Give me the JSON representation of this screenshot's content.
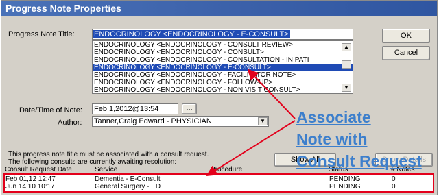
{
  "window": {
    "title": "Progress Note Properties"
  },
  "form": {
    "title_label": "Progress Note Title:",
    "title_value": "ENDOCRINOLOGY  <ENDOCRINOLOGY - E-CONSULT>",
    "title_options": [
      "ENDOCRINOLOGY  <ENDOCRINOLOGY - CONSULT REVIEW>",
      "ENDOCRINOLOGY  <ENDOCRINOLOGY - CONSULT>",
      "ENDOCRINOLOGY  <ENDOCRINOLOGY - CONSULTATION - IN PATI",
      "ENDOCRINOLOGY  <ENDOCRINOLOGY - E-CONSULT>",
      "ENDOCRINOLOGY  <ENDOCRINOLOGY - FACILITATOR NOTE>",
      "ENDOCRINOLOGY  <ENDOCRINOLOGY - FOLLOW-UP>",
      "ENDOCRINOLOGY  <ENDOCRINOLOGY - NON VISIT CONSULT>"
    ],
    "selected_option_index": 3,
    "date_label": "Date/Time of Note:",
    "date_value": "Feb 1,2012@13:54",
    "date_button": "...",
    "author_label": "Author:",
    "author_value": "Tanner,Craig Edward - PHYSICIAN",
    "dropdown_glyph": "▼",
    "scroll_up_glyph": "▲",
    "scroll_down_glyph": "▼"
  },
  "buttons": {
    "ok": "OK",
    "cancel": "Cancel",
    "show_all": "Show All",
    "show_details": "Show Details"
  },
  "message": {
    "line1": "This progress note title must be associated with a consult request.",
    "line2": "The following consults are currently awaiting resolution:"
  },
  "consults": {
    "headers": [
      "Consult Request Date",
      "Service",
      "Procedure",
      "Status",
      "# Notes"
    ],
    "rows": [
      {
        "date": "Feb 01,12 12:47",
        "service": "Dementia - E-Consult",
        "procedure": "",
        "status": "PENDING",
        "notes": "0"
      },
      {
        "date": "Jun 14,10 10:17",
        "service": "General Surgery - ED",
        "procedure": "",
        "status": "PENDING",
        "notes": "0"
      }
    ]
  },
  "annotation": {
    "line1": "Associate",
    "line2": "Note with",
    "line3": "Consult Request",
    "color": "#3d7fcc",
    "arrow_color": "#e3001b"
  }
}
